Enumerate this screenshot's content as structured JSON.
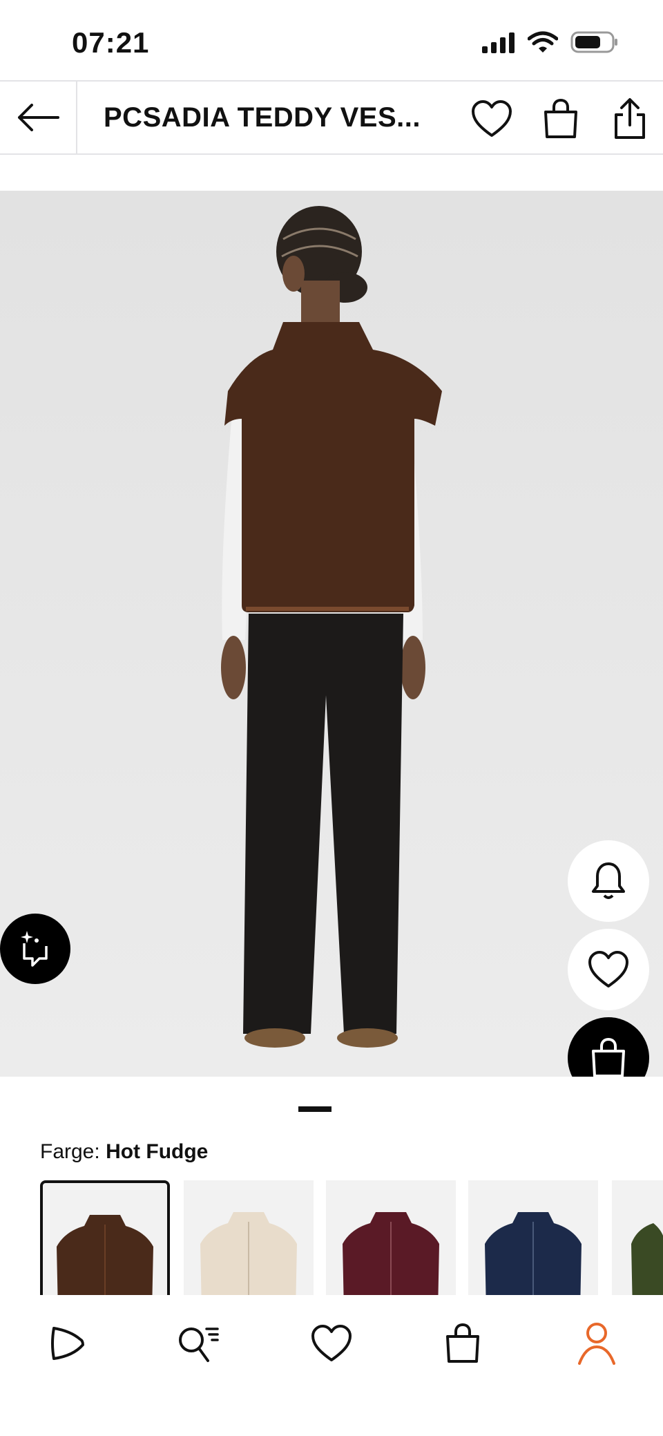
{
  "status": {
    "time": "07:21"
  },
  "header": {
    "title": "PCSADIA TEDDY VES..."
  },
  "product": {
    "color_label": "Farge:",
    "color_value": "Hot Fudge",
    "swatch_colors": [
      "#4a2a1a",
      "#e8dccb",
      "#5a1a26",
      "#1c2a4a",
      "#3a4a24"
    ]
  },
  "colors": {
    "accent": "#e8682a",
    "text": "#111111"
  },
  "icons": {
    "back": "arrow-left-icon",
    "favorite": "heart-icon",
    "bag": "shopping-bag-icon",
    "share": "share-icon",
    "notify": "bell-icon",
    "visual_search": "visual-search-icon",
    "tabs": [
      "play-icon",
      "search-list-icon",
      "heart-icon",
      "shopping-bag-icon",
      "profile-icon"
    ]
  }
}
